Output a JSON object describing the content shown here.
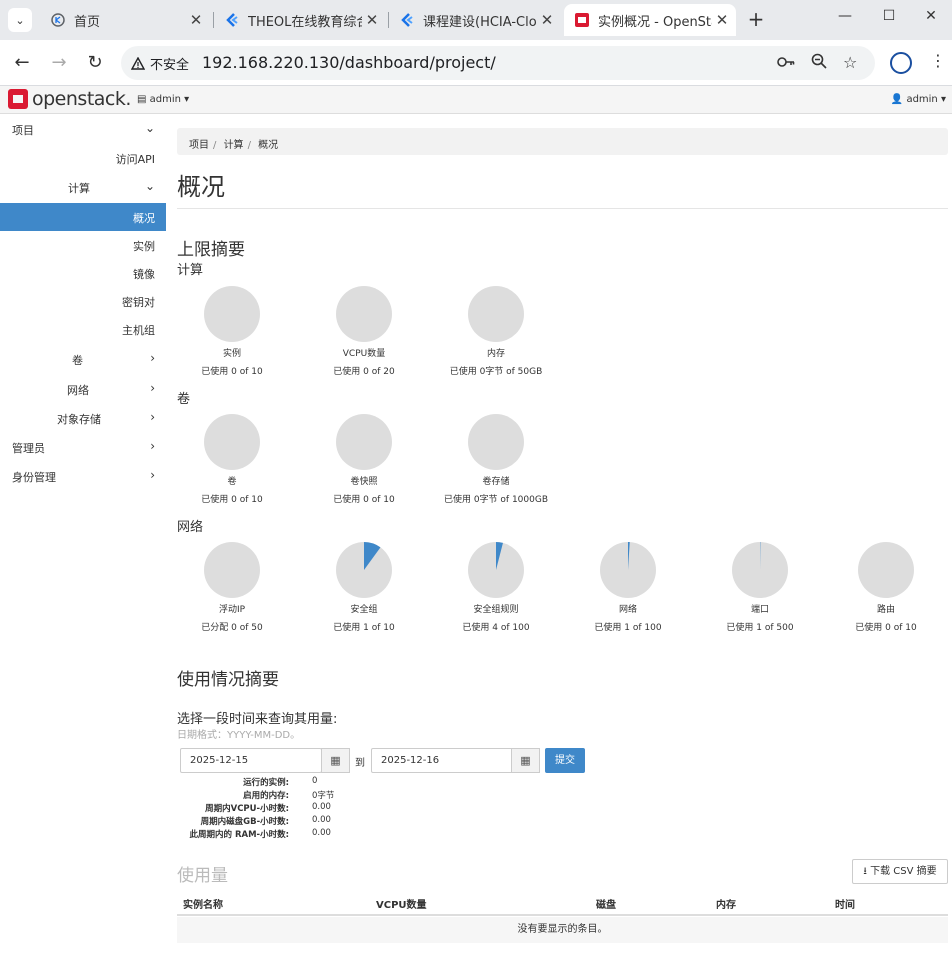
{
  "browser": {
    "tabs": [
      {
        "title": "首页"
      },
      {
        "title": "THEOL在线教育综合"
      },
      {
        "title": "课程建设(HCIA-Clo"
      },
      {
        "title": "实例概况 - OpenSta"
      }
    ],
    "security_label": "不安全",
    "url": "192.168.220.130/dashboard/project/"
  },
  "header": {
    "logo_text": "openstack.",
    "project": "admin",
    "user": "admin"
  },
  "sidebar": {
    "items": [
      {
        "label": "项目"
      },
      {
        "label": "访问API"
      },
      {
        "label": "计算"
      },
      {
        "label": "概况"
      },
      {
        "label": "实例"
      },
      {
        "label": "镜像"
      },
      {
        "label": "密钥对"
      },
      {
        "label": "主机组"
      },
      {
        "label": "卷"
      },
      {
        "label": "网络"
      },
      {
        "label": "对象存储"
      },
      {
        "label": "管理员"
      },
      {
        "label": "身份管理"
      }
    ]
  },
  "breadcrumb": [
    "项目",
    "计算",
    "概况"
  ],
  "page_title": "概况",
  "limits": {
    "title": "上限摘要",
    "groups": [
      {
        "name": "计算",
        "items": [
          {
            "label": "实例",
            "usage": "已使用 0 of 10",
            "fraction": 0
          },
          {
            "label": "VCPU数量",
            "usage": "已使用 0 of 20",
            "fraction": 0
          },
          {
            "label": "内存",
            "usage": "已使用 0字节 of 50GB",
            "fraction": 0
          }
        ]
      },
      {
        "name": "卷",
        "items": [
          {
            "label": "卷",
            "usage": "已使用 0 of 10",
            "fraction": 0
          },
          {
            "label": "卷快照",
            "usage": "已使用 0 of 10",
            "fraction": 0
          },
          {
            "label": "卷存储",
            "usage": "已使用 0字节 of 1000GB",
            "fraction": 0
          }
        ]
      },
      {
        "name": "网络",
        "items": [
          {
            "label": "浮动IP",
            "usage": "已分配 0 of 50",
            "fraction": 0
          },
          {
            "label": "安全组",
            "usage": "已使用 1 of 10",
            "fraction": 0.1
          },
          {
            "label": "安全组规则",
            "usage": "已使用 4 of 100",
            "fraction": 0.04
          },
          {
            "label": "网络",
            "usage": "已使用 1 of 100",
            "fraction": 0.01
          },
          {
            "label": "端口",
            "usage": "已使用 1 of 500",
            "fraction": 0.002
          },
          {
            "label": "路由",
            "usage": "已使用 0 of 10",
            "fraction": 0
          }
        ]
      }
    ],
    "colors": {
      "empty": "#dddddd",
      "used": "#3f88c9"
    }
  },
  "usage": {
    "title": "使用情况摘要",
    "query_label": "选择一段时间来查询其用量:",
    "date_help": "日期格式：YYYY-MM-DD。",
    "start_date": "2025-12-15",
    "to_label": "到",
    "end_date": "2025-12-16",
    "submit_label": "提交",
    "stats": [
      {
        "label": "运行的实例:",
        "value": "0"
      },
      {
        "label": "启用的内存:",
        "value": "0字节"
      },
      {
        "label": "周期内VCPU-小时数:",
        "value": "0.00"
      },
      {
        "label": "周期内磁盘GB-小时数:",
        "value": "0.00"
      },
      {
        "label": "此周期内的 RAM-小时数:",
        "value": "0.00"
      }
    ],
    "table_title": "使用量",
    "csv_label": "下载 CSV 摘要",
    "columns": [
      "实例名称",
      "VCPU数量",
      "磁盘",
      "内存",
      "时间"
    ],
    "empty_text": "没有要显示的条目。"
  }
}
